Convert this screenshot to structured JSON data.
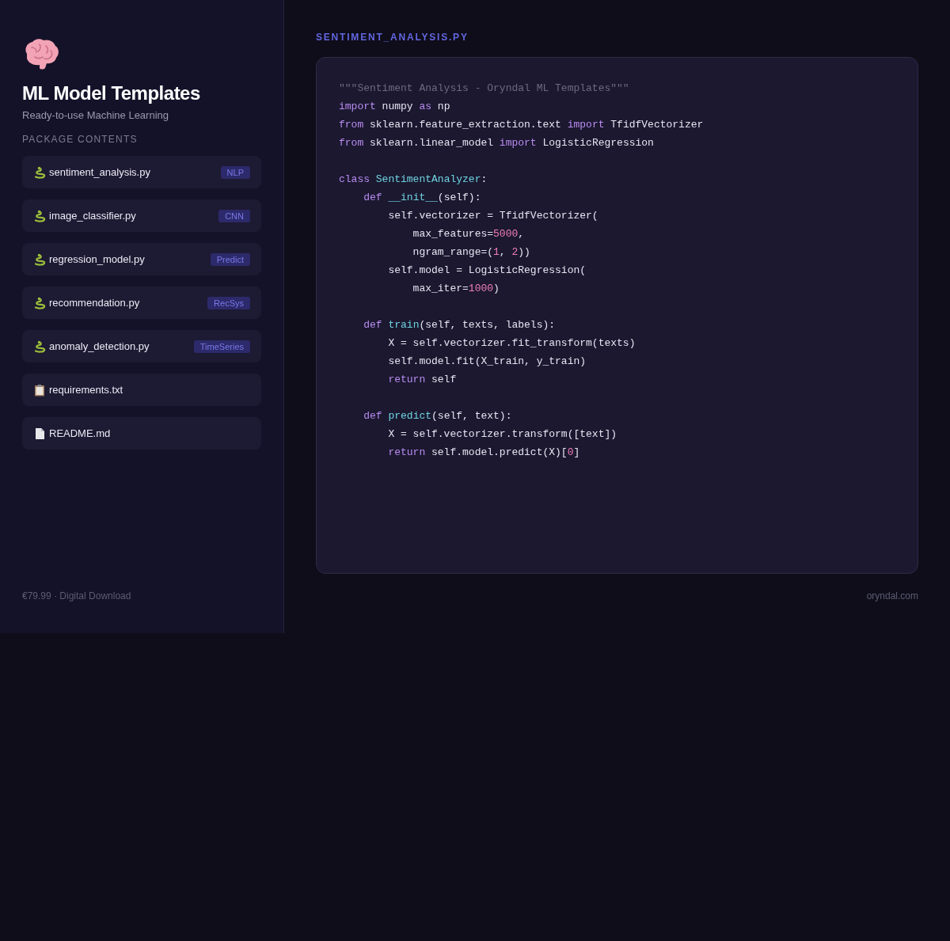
{
  "sidebar": {
    "title": "ML Model Templates",
    "subtitle": "Ready-to-use Machine Learning",
    "section_label": "PACKAGE CONTENTS",
    "files": [
      {
        "name": "sentiment_analysis.py",
        "kind": "python",
        "tag": "NLP"
      },
      {
        "name": "image_classifier.py",
        "kind": "python",
        "tag": "CNN"
      },
      {
        "name": "regression_model.py",
        "kind": "python",
        "tag": "Predict"
      },
      {
        "name": "recommendation.py",
        "kind": "python",
        "tag": "RecSys"
      },
      {
        "name": "anomaly_detection.py",
        "kind": "python",
        "tag": "TimeSeries"
      },
      {
        "name": "requirements.txt",
        "kind": "list"
      },
      {
        "name": "README.md",
        "kind": "document"
      }
    ],
    "footer": "€79.99 · Digital Download"
  },
  "editor": {
    "filename": "SENTIMENT_ANALYSIS.PY",
    "lines": [
      {
        "kind": "code",
        "tokens": [
          {
            "t": "\"\"\"Sentiment Analysis - Oryndal ML Templates\"\"\"",
            "kind": "comment"
          }
        ]
      },
      {
        "kind": "code",
        "tokens": [
          {
            "t": "import",
            "kind": "keyword"
          },
          {
            "t": " numpy ",
            "kind": "plain"
          },
          {
            "t": "as",
            "kind": "keyword"
          },
          {
            "t": " np",
            "kind": "plain"
          }
        ]
      },
      {
        "kind": "code",
        "tokens": [
          {
            "t": "from",
            "kind": "keyword"
          },
          {
            "t": " sklearn.feature_extraction.text ",
            "kind": "plain"
          },
          {
            "t": "import",
            "kind": "keyword"
          },
          {
            "t": " TfidfVectorizer",
            "kind": "plain"
          }
        ]
      },
      {
        "kind": "code",
        "tokens": [
          {
            "t": "from",
            "kind": "keyword"
          },
          {
            "t": " sklearn.linear_model ",
            "kind": "plain"
          },
          {
            "t": "import",
            "kind": "keyword"
          },
          {
            "t": " LogisticRegression",
            "kind": "plain"
          }
        ]
      },
      {
        "kind": "blank"
      },
      {
        "kind": "code",
        "tokens": [
          {
            "t": "class ",
            "kind": "keyword"
          },
          {
            "t": "SentimentAnalyzer",
            "kind": "name"
          },
          {
            "t": ":",
            "kind": "plain"
          }
        ]
      },
      {
        "kind": "code",
        "tokens": [
          {
            "t": "    def ",
            "kind": "keyword"
          },
          {
            "t": "__init__",
            "kind": "name"
          },
          {
            "t": "(self):",
            "kind": "plain"
          }
        ]
      },
      {
        "kind": "code",
        "tokens": [
          {
            "t": "        self.vectorizer = TfidfVectorizer(",
            "kind": "plain"
          }
        ]
      },
      {
        "kind": "code",
        "tokens": [
          {
            "t": "            max_features=",
            "kind": "plain"
          },
          {
            "t": "5000",
            "kind": "number"
          },
          {
            "t": ",",
            "kind": "plain"
          }
        ]
      },
      {
        "kind": "code",
        "tokens": [
          {
            "t": "            ngram_range=(",
            "kind": "plain"
          },
          {
            "t": "1",
            "kind": "number"
          },
          {
            "t": ", ",
            "kind": "plain"
          },
          {
            "t": "2",
            "kind": "number"
          },
          {
            "t": "))",
            "kind": "plain"
          }
        ]
      },
      {
        "kind": "code",
        "tokens": [
          {
            "t": "        self.model = LogisticRegression(",
            "kind": "plain"
          }
        ]
      },
      {
        "kind": "code",
        "tokens": [
          {
            "t": "            max_iter=",
            "kind": "plain"
          },
          {
            "t": "1000",
            "kind": "number"
          },
          {
            "t": ")",
            "kind": "plain"
          }
        ]
      },
      {
        "kind": "blank"
      },
      {
        "kind": "code",
        "tokens": [
          {
            "t": "    def ",
            "kind": "keyword"
          },
          {
            "t": "train",
            "kind": "name"
          },
          {
            "t": "(self, texts, labels):",
            "kind": "plain"
          }
        ]
      },
      {
        "kind": "code",
        "tokens": [
          {
            "t": "        X = self.vectorizer.fit_transform(texts)",
            "kind": "plain"
          }
        ]
      },
      {
        "kind": "code",
        "tokens": [
          {
            "t": "        self.model.fit(X_train, y_train)",
            "kind": "plain"
          }
        ]
      },
      {
        "kind": "code",
        "tokens": [
          {
            "t": "        return",
            "kind": "keyword"
          },
          {
            "t": " self",
            "kind": "plain"
          }
        ]
      },
      {
        "kind": "blank"
      },
      {
        "kind": "code",
        "tokens": [
          {
            "t": "    def ",
            "kind": "keyword"
          },
          {
            "t": "predict",
            "kind": "name"
          },
          {
            "t": "(self, text):",
            "kind": "plain"
          }
        ]
      },
      {
        "kind": "code",
        "tokens": [
          {
            "t": "        X = self.vectorizer.transform([text])",
            "kind": "plain"
          }
        ]
      },
      {
        "kind": "code",
        "tokens": [
          {
            "t": "        return",
            "kind": "keyword"
          },
          {
            "t": " self.model.predict(X)[",
            "kind": "plain"
          },
          {
            "t": "0",
            "kind": "number"
          },
          {
            "t": "]",
            "kind": "plain"
          }
        ]
      }
    ],
    "footer": "oryndal.com"
  }
}
